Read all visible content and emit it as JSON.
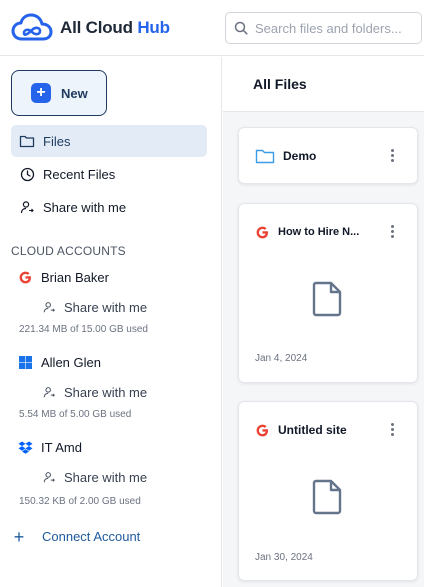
{
  "app": {
    "name_main": "All Cloud",
    "name_accent": "Hub"
  },
  "search": {
    "placeholder": "Search files and folders..."
  },
  "sidebar": {
    "new_label": "New",
    "nav": [
      {
        "label": "Files",
        "icon": "folder-icon",
        "active": true
      },
      {
        "label": "Recent Files",
        "icon": "clock-icon",
        "active": false
      },
      {
        "label": "Share with me",
        "icon": "shared-user-icon",
        "active": false
      }
    ],
    "section_title": "CLOUD ACCOUNTS",
    "accounts": [
      {
        "name": "Brian Baker",
        "provider": "google-drive",
        "icon": "google-icon",
        "share_label": "Share with me",
        "usage": "221.34 MB of 15.00 GB used"
      },
      {
        "name": "Allen Glen",
        "provider": "onedrive",
        "icon": "windows-icon",
        "share_label": "Share with me",
        "usage": "5.54 MB of 5.00 GB used"
      },
      {
        "name": "IT Amd",
        "provider": "dropbox",
        "icon": "dropbox-icon",
        "share_label": "Share with me",
        "usage": "150.32 KB of 2.00 GB used"
      }
    ],
    "connect_label": "Connect Account"
  },
  "main": {
    "title": "All Files",
    "items": [
      {
        "type": "folder",
        "name": "Demo",
        "icon": "folder-icon"
      },
      {
        "type": "file",
        "name": "How to Hire N...",
        "icon": "google-icon",
        "date": "Jan 4, 2024"
      },
      {
        "type": "file",
        "name": "Untitled site",
        "icon": "google-icon",
        "date": "Jan 30, 2024"
      }
    ]
  },
  "colors": {
    "accent": "#2563eb",
    "brand_dark": "#1e3a5f",
    "active_bg": "#e3ecf6",
    "google_red": "#ea4335",
    "windows_blue": "#1a73e8",
    "dropbox_blue": "#0061fe"
  }
}
